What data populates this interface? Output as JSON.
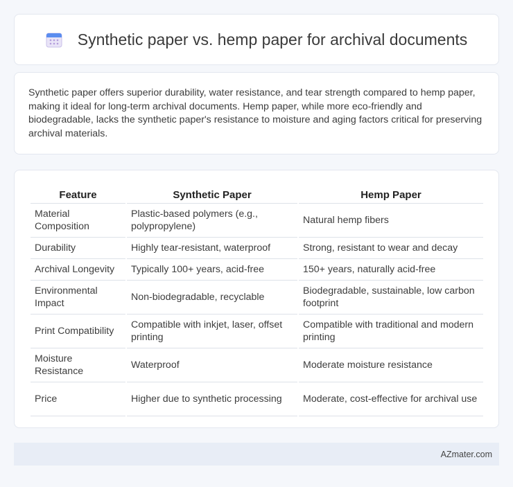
{
  "header": {
    "title": "Synthetic paper vs. hemp paper for archival documents",
    "icon": "calendar-icon"
  },
  "summary": {
    "text": "Synthetic paper offers superior durability, water resistance, and tear strength compared to hemp paper, making it ideal for long-term archival documents. Hemp paper, while more eco-friendly and biodegradable, lacks the synthetic paper's resistance to moisture and aging factors critical for preserving archival materials."
  },
  "table": {
    "headers": [
      "Feature",
      "Synthetic Paper",
      "Hemp Paper"
    ],
    "rows": [
      [
        "Material Composition",
        "Plastic-based polymers (e.g., polypropylene)",
        "Natural hemp fibers"
      ],
      [
        "Durability",
        "Highly tear-resistant, waterproof",
        "Strong, resistant to wear and decay"
      ],
      [
        "Archival Longevity",
        "Typically 100+ years, acid-free",
        "150+ years, naturally acid-free"
      ],
      [
        "Environmental Impact",
        "Non-biodegradable, recyclable",
        "Biodegradable, sustainable, low carbon footprint"
      ],
      [
        "Print Compatibility",
        "Compatible with inkjet, laser, offset printing",
        "Compatible with traditional and modern printing"
      ],
      [
        "Moisture Resistance",
        "Waterproof",
        "Moderate moisture resistance"
      ],
      [
        "Price",
        "Higher due to synthetic processing",
        "Moderate, cost-effective for archival use"
      ]
    ]
  },
  "footer": {
    "site": "AZmater.com"
  }
}
